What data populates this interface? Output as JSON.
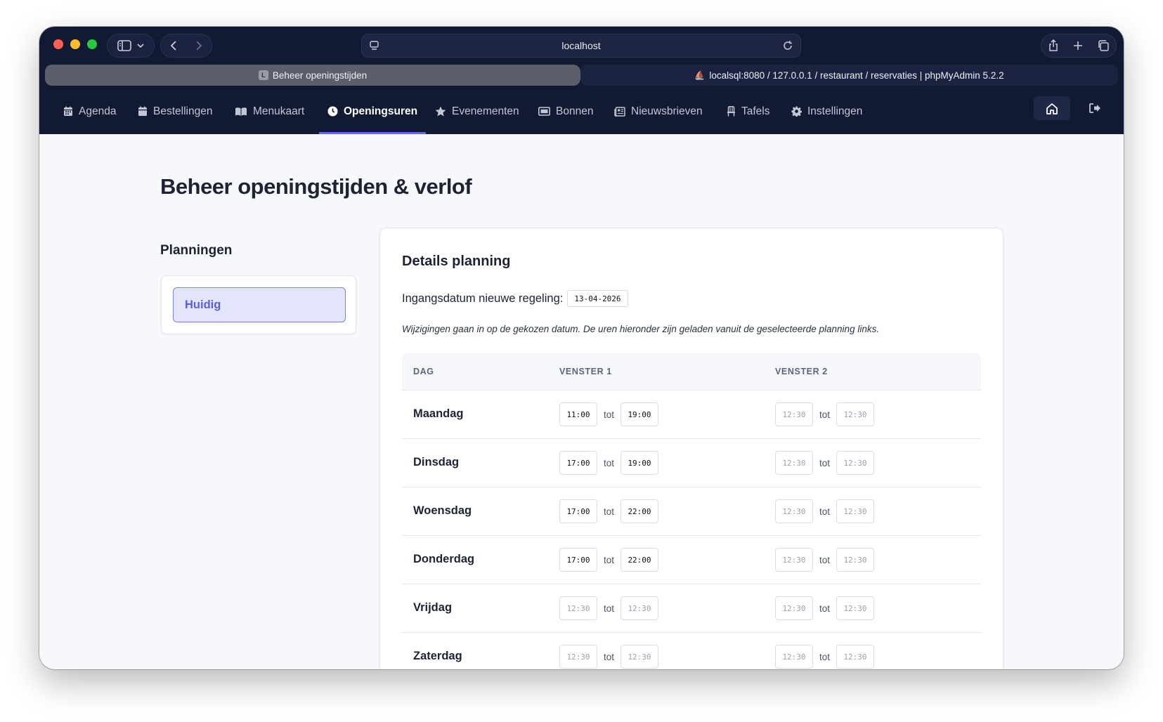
{
  "browser": {
    "address": "localhost",
    "tabs": [
      {
        "favicon": "L",
        "title": "Beheer openingstijden"
      },
      {
        "favicon": "⛵",
        "title": "localsql:8080 / 127.0.0.1 / restaurant / reservaties | phpMyAdmin 5.2.2"
      }
    ]
  },
  "nav": {
    "items": [
      {
        "label": "Agenda",
        "icon": "calendar-icon"
      },
      {
        "label": "Bestellingen",
        "icon": "calendar-icon"
      },
      {
        "label": "Menukaart",
        "icon": "book-icon"
      },
      {
        "label": "Openingsuren",
        "icon": "clock-icon",
        "active": true
      },
      {
        "label": "Evenementen",
        "icon": "star-icon"
      },
      {
        "label": "Bonnen",
        "icon": "ticket-icon"
      },
      {
        "label": "Nieuwsbrieven",
        "icon": "newspaper-icon"
      },
      {
        "label": "Tafels",
        "icon": "chair-icon"
      },
      {
        "label": "Instellingen",
        "icon": "gear-icon"
      }
    ],
    "accent": "#6366f1"
  },
  "page": {
    "title": "Beheer openingstijden & verlof"
  },
  "plannings": {
    "heading": "Planningen",
    "items": [
      {
        "label": "Huidig",
        "selected": true
      }
    ]
  },
  "details": {
    "heading": "Details planning",
    "effective_label": "Ingangsdatum nieuwe regeling:",
    "effective_date": "13-04-2026",
    "note": "Wijzigingen gaan in op de gekozen datum. De uren hieronder zijn geladen vanuit de geselecteerde planning links.",
    "columns": [
      "DAG",
      "VENSTER 1",
      "VENSTER 2"
    ],
    "sep": "tot",
    "rows": [
      {
        "day": "Maandag",
        "w1_from": "11:00",
        "w1_to": "19:00",
        "w2_from": "12:30",
        "w2_to": "12:30",
        "w1_empty": false
      },
      {
        "day": "Dinsdag",
        "w1_from": "17:00",
        "w1_to": "19:00",
        "w2_from": "12:30",
        "w2_to": "12:30",
        "w1_empty": false
      },
      {
        "day": "Woensdag",
        "w1_from": "17:00",
        "w1_to": "22:00",
        "w2_from": "12:30",
        "w2_to": "12:30",
        "w1_empty": false
      },
      {
        "day": "Donderdag",
        "w1_from": "17:00",
        "w1_to": "22:00",
        "w2_from": "12:30",
        "w2_to": "12:30",
        "w1_empty": false
      },
      {
        "day": "Vrijdag",
        "w1_from": "12:30",
        "w1_to": "12:30",
        "w2_from": "12:30",
        "w2_to": "12:30",
        "w1_empty": true
      },
      {
        "day": "Zaterdag",
        "w1_from": "12:30",
        "w1_to": "12:30",
        "w2_from": "12:30",
        "w2_to": "12:30",
        "w1_empty": true
      }
    ]
  }
}
